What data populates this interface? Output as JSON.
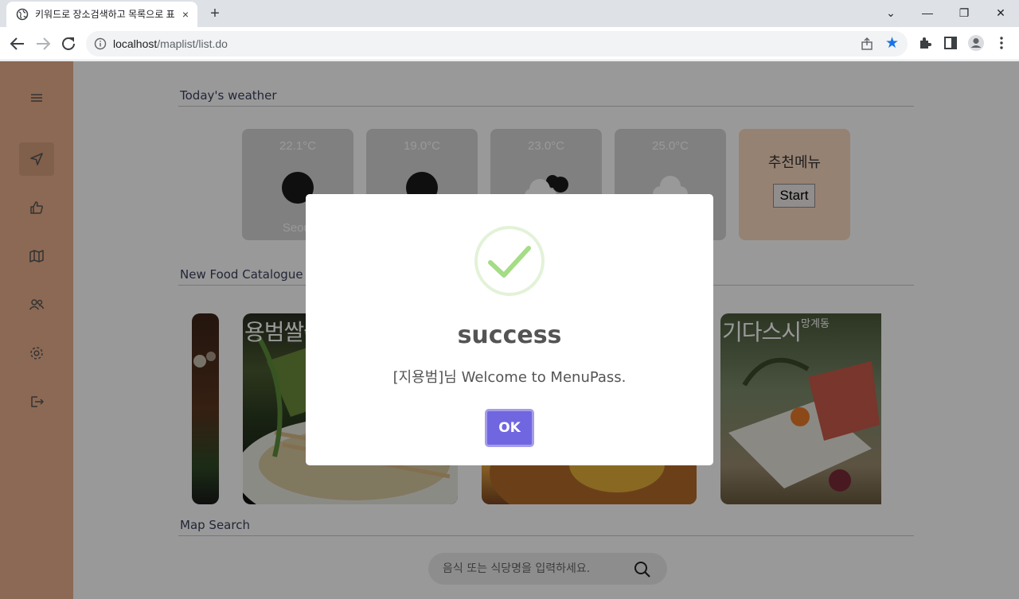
{
  "browser": {
    "tab_title": "키워드로 장소검색하고 목록으로 표출하기",
    "new_tab": "+",
    "tab_close": "×",
    "url_host": "localhost",
    "url_path": "/maplist/list.do",
    "window_controls": {
      "tab_search": "⌄",
      "minimize": "—",
      "restore": "❐",
      "close": "✕"
    }
  },
  "sidebar": {
    "items": [
      {
        "icon": "menu-icon"
      },
      {
        "icon": "navigation-icon",
        "active": true
      },
      {
        "icon": "thumbs-up-icon"
      },
      {
        "icon": "map-icon"
      },
      {
        "icon": "users-icon"
      },
      {
        "icon": "settings-icon"
      },
      {
        "icon": "logout-icon"
      }
    ]
  },
  "weather": {
    "title": "Today's weather",
    "cards": [
      {
        "temp": "22.1°C",
        "icon": "night-clear-icon",
        "city": "Seoul"
      },
      {
        "temp": "19.0°C",
        "icon": "night-clear-icon",
        "city": ""
      },
      {
        "temp": "23.0°C",
        "icon": "cloudy-icon",
        "city": ""
      },
      {
        "temp": "25.0°C",
        "icon": "cloud-icon",
        "city": ""
      }
    ],
    "recommend": {
      "title": "추천메뉴",
      "button": "Start"
    }
  },
  "catalog": {
    "title": "New Food Catalogue",
    "items": [
      {
        "name": "",
        "sub": ""
      },
      {
        "name": "용범쌀국수",
        "sub": ""
      },
      {
        "name": "",
        "sub": ""
      },
      {
        "name": "기다스시",
        "sub": "망계동"
      }
    ]
  },
  "map_search": {
    "title": "Map Search",
    "placeholder": "음식 또는 식당명을 입력하세요."
  },
  "modal": {
    "icon": "success-check-icon",
    "title": "success",
    "message": "[지용범]님 Welcome to MenuPass.",
    "ok": "OK",
    "colors": {
      "confirm": "#7066e0",
      "check": "#a5dc86"
    }
  }
}
